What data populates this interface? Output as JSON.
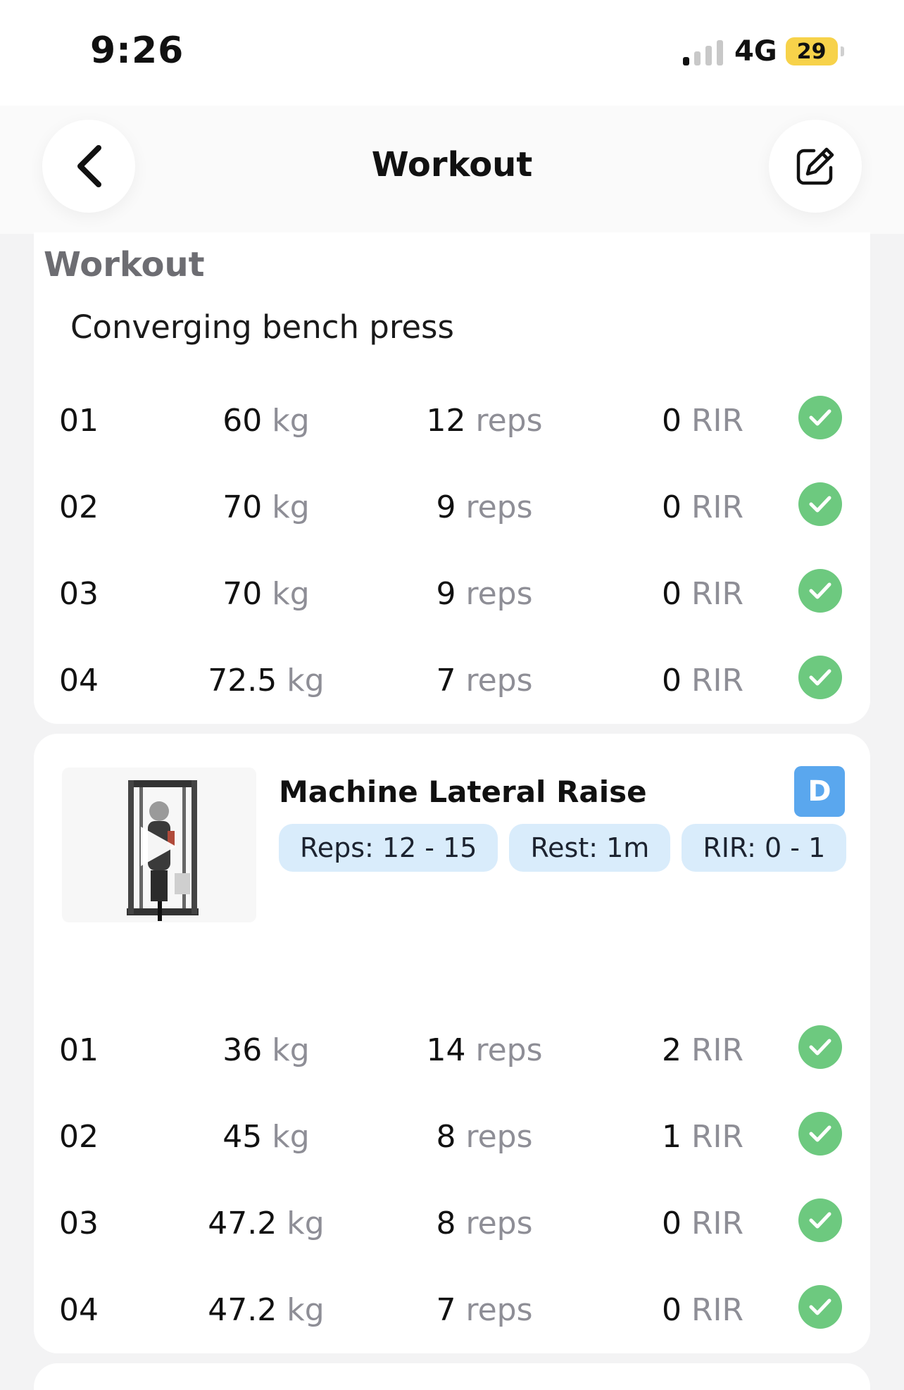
{
  "status_bar": {
    "time": "9:26",
    "network": "4G",
    "battery": "29"
  },
  "nav": {
    "title": "Workout",
    "back_icon": "chevron-left-icon",
    "edit_icon": "edit-icon"
  },
  "section_label": "Workout",
  "exercises": [
    {
      "name": "Converging bench press",
      "sets": [
        {
          "num": "01",
          "weight": "60",
          "weight_unit": "kg",
          "reps": "12",
          "reps_unit": "reps",
          "rir": "0",
          "rir_unit": "RIR"
        },
        {
          "num": "02",
          "weight": "70",
          "weight_unit": "kg",
          "reps": "9",
          "reps_unit": "reps",
          "rir": "0",
          "rir_unit": "RIR"
        },
        {
          "num": "03",
          "weight": "70",
          "weight_unit": "kg",
          "reps": "9",
          "reps_unit": "reps",
          "rir": "0",
          "rir_unit": "RIR"
        },
        {
          "num": "04",
          "weight": "72.5",
          "weight_unit": "kg",
          "reps": "7",
          "reps_unit": "reps",
          "rir": "0",
          "rir_unit": "RIR"
        }
      ]
    },
    {
      "name": "Machine Lateral Raise",
      "badge": "D",
      "chips": {
        "reps": "Reps: 12 - 15",
        "rest": "Rest: 1m",
        "rir": "RIR: 0 - 1"
      },
      "sets": [
        {
          "num": "01",
          "weight": "36",
          "weight_unit": "kg",
          "reps": "14",
          "reps_unit": "reps",
          "rir": "2",
          "rir_unit": "RIR"
        },
        {
          "num": "02",
          "weight": "45",
          "weight_unit": "kg",
          "reps": "8",
          "reps_unit": "reps",
          "rir": "1",
          "rir_unit": "RIR"
        },
        {
          "num": "03",
          "weight": "47.2",
          "weight_unit": "kg",
          "reps": "8",
          "reps_unit": "reps",
          "rir": "0",
          "rir_unit": "RIR"
        },
        {
          "num": "04",
          "weight": "47.2",
          "weight_unit": "kg",
          "reps": "7",
          "reps_unit": "reps",
          "rir": "0",
          "rir_unit": "RIR"
        }
      ]
    }
  ],
  "colors": {
    "check": "#6dc97f",
    "chip_bg": "#d9ecfb",
    "badge": "#5aa7ee",
    "unit_text": "#8e8e96"
  }
}
